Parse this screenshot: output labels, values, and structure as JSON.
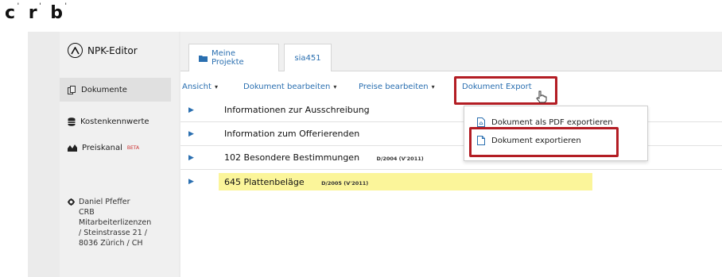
{
  "logo": {
    "letters": [
      "c",
      "r",
      "b"
    ]
  },
  "sidebar": {
    "brand": "NPK-Editor",
    "items": [
      {
        "label": "Dokumente",
        "icon": "documents-icon",
        "active": true
      },
      {
        "label": "Kostenkennwerte",
        "icon": "database-icon",
        "active": false
      },
      {
        "label": "Preiskanal",
        "badge": "BETA",
        "icon": "chart-icon",
        "active": false
      }
    ],
    "user": {
      "icon": "gear-icon",
      "lines": [
        "Daniel Pfeffer",
        "CRB",
        "Mitarbeiterlizenzen",
        "/ Steinstrasse 21 /",
        "8036 Zürich / CH"
      ]
    }
  },
  "tabs": [
    {
      "label": "Meine Projekte",
      "icon": "folder-icon"
    },
    {
      "label": "sia451"
    }
  ],
  "menubar": {
    "items": [
      "Ansicht",
      "Dokument bearbeiten",
      "Preise bearbeiten",
      "Dokument Export"
    ]
  },
  "dropdown": {
    "items": [
      {
        "label": "Dokument als PDF exportieren",
        "icon": "pdf-file-icon"
      },
      {
        "label": "Dokument exportieren",
        "icon": "file-icon"
      }
    ]
  },
  "rows": [
    {
      "title": "Informationen zur Ausschreibung",
      "tag": ""
    },
    {
      "title": "Information zum Offerierenden",
      "tag": ""
    },
    {
      "title": "102 Besondere Bestimmungen",
      "tag": "D/2004 (V'2011)"
    },
    {
      "title": "645 Plattenbeläge",
      "tag": "D/2005 (V'2011)",
      "highlighted": true
    }
  ],
  "colors": {
    "accent": "#2a6fb0",
    "callout": "#b31d24",
    "highlight": "#fbf59a"
  }
}
